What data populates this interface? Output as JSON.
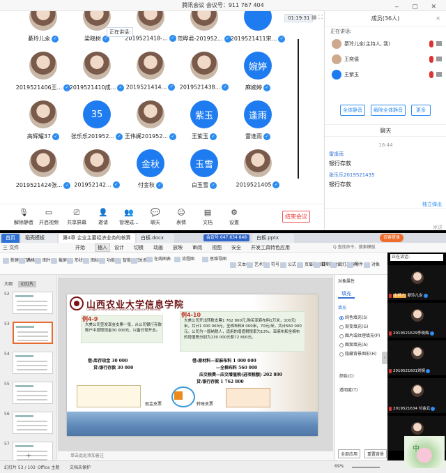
{
  "meeting": {
    "window_title": "腾讯会议 会议号：911 767 404",
    "timer": "01:19:31",
    "speaking_tip": "正在讲话:",
    "participants": [
      {
        "name": "綦玲儿氽",
        "kind": "photo",
        "label": ""
      },
      {
        "name": "梁晓树",
        "kind": "photo",
        "label": ""
      },
      {
        "name": "2019521418-...",
        "kind": "photo",
        "label": ""
      },
      {
        "name": "范晔君-201952...",
        "kind": "photo",
        "label": ""
      },
      {
        "name": "2019521411宋...",
        "kind": "blue",
        "label": ""
      },
      {
        "name": "2019521406王...",
        "kind": "photo",
        "label": ""
      },
      {
        "name": "2019521410成...",
        "kind": "photo",
        "label": ""
      },
      {
        "name": "2019521414...",
        "kind": "photo",
        "label": ""
      },
      {
        "name": "2019521438...",
        "kind": "photo",
        "label": ""
      },
      {
        "name": "麻婉婷",
        "kind": "blue",
        "label": "婉婷"
      },
      {
        "name": "高辉耀37",
        "kind": "photo",
        "label": ""
      },
      {
        "name": "张乐乐201952...",
        "kind": "blue",
        "label": "35"
      },
      {
        "name": "王伟娓201952...",
        "kind": "photo",
        "label": ""
      },
      {
        "name": "王紫玉",
        "kind": "blue",
        "label": "紫玉"
      },
      {
        "name": "雷逢雨",
        "kind": "blue",
        "label": "逢雨"
      },
      {
        "name": "2019521424张...",
        "kind": "photo",
        "label": ""
      },
      {
        "name": "201952142...",
        "kind": "photo",
        "label": ""
      },
      {
        "name": "付金秋",
        "kind": "blue",
        "label": "金秋"
      },
      {
        "name": "白玉雪",
        "kind": "blue",
        "label": "玉雪"
      },
      {
        "name": "2019521405",
        "kind": "photo",
        "label": ""
      }
    ],
    "toolbar": [
      {
        "icon": "mic-icon",
        "label": "解除静音"
      },
      {
        "icon": "camera-icon",
        "label": "开启视频"
      },
      {
        "icon": "screen-share-icon",
        "label": "共享屏幕"
      },
      {
        "icon": "invite-icon",
        "label": "邀请"
      },
      {
        "icon": "members-icon",
        "label": "管理成..."
      },
      {
        "icon": "chat-icon",
        "label": "聊天"
      },
      {
        "icon": "emoji-icon",
        "label": "表情"
      },
      {
        "icon": "document-icon",
        "label": "文档"
      },
      {
        "icon": "settings-icon",
        "label": "设置"
      }
    ],
    "end_button": "结束会议",
    "members_title": "成员(36人)",
    "members_speaking": "正在讲话:",
    "members": [
      {
        "name": "綦玲儿氽(主持人, 我)",
        "kind": "photo"
      },
      {
        "name": "王奕僖",
        "kind": "photo"
      },
      {
        "name": "王紫玉",
        "kind": "blue"
      }
    ],
    "mute_all": "全体静音",
    "unmute_all": "解除全体静音",
    "more": "更多",
    "chat_title": "聊天",
    "chat_time": "16:44",
    "chat_messages": [
      {
        "name": "雷逢雨",
        "text": "银行存款"
      },
      {
        "name": "张乐乐2019521435",
        "text": "银行存款"
      }
    ],
    "popout": "独立弹出",
    "send": "发送"
  },
  "wps": {
    "tabs": [
      "首页",
      "稻壳模板",
      "第4章 企业主要经济业务的核算",
      "白板.docx",
      "会议号 647 834 848",
      "白板.pptx"
    ],
    "login": "访客登录",
    "menus": [
      "三 文件",
      "开始",
      "插入",
      "设计",
      "切换",
      "动画",
      "放映",
      "审阅",
      "视图",
      "安全",
      "开发工具",
      "特色应用"
    ],
    "active_menu": "插入",
    "search": "Q 查找命令、搜索模板",
    "ribbon": [
      "新建幻灯片",
      "表格",
      "图片",
      "截屏",
      "形状",
      "图标",
      "功能图",
      "智能图形",
      "关系图",
      "在线图表",
      "流程图",
      "思维导图",
      "文本框",
      "艺术字",
      "符号",
      "公式",
      "页眉和页脚",
      "日期和时间",
      "幻灯片编号",
      "附件",
      "对象"
    ],
    "outline_tab": "大纲",
    "slides_tab": "幻灯片",
    "thumb_numbers": [
      "52",
      "53",
      "54",
      "55",
      "56",
      "57"
    ],
    "slide": {
      "uni_name": "山西农业大学信息学院",
      "uni_en": "College of Information, Shanxi Agricultural University",
      "ex1_title": "例4-9",
      "ex1_text": "大美公司签发现金支票一张，从公司银行存款账户中提取现金30 000元，以备日常开支。",
      "ex1_entry": [
        "借:库存现金        30 000",
        "贷:银行存款        30 000"
      ],
      "ex2_title": "例4-10",
      "ex2_text": "大美公司开出转账支票1 762 800元,购买亚麻布料1万米，100元/米，共计1 000 000元，全棉布料8 000米，70元/米，共计560 000元。公司为一般纳税人，适用的增值税税率为13%。亚麻布和全棉布的增值税分别为130 000元和72 800元。",
      "ex2_entry": [
        "借:原材料—亚麻布料              1 000 000",
        "—全棉布料                560 000",
        "应交税费—应交增值税(进项税额)   202 800",
        "贷:银行存款                    1 762 800"
      ],
      "cheque_label1": "现金支票",
      "cheque_label2": "转账支票",
      "cheque_center": "银行"
    },
    "notes_placeholder": "单击此处添加备注",
    "status": [
      "幻灯片 53 / 103",
      "Office 主题",
      "文档未保护"
    ],
    "zoom": "69%",
    "props": {
      "title": "对象属性",
      "fill_tab": "填充",
      "fill_label": "填充",
      "options": [
        "纯色填充(S)",
        "渐变填充(G)",
        "图片或纹理填充(P)",
        "图案填充(A)",
        "隐藏背景图形(H)"
      ],
      "color": "颜色(C)",
      "transparency": "透明度(T)",
      "apply_all": "全部应用",
      "reset": "重置背景"
    },
    "video": {
      "speaking": "正在讲话:",
      "tiles": [
        {
          "label": "綦玲儿氽",
          "host": "主持人"
        },
        {
          "label": "2019521629李晓梅",
          "host": ""
        },
        {
          "label": "2019521601刘婉",
          "host": ""
        },
        {
          "label": "2019521634 付金云",
          "host": ""
        },
        {
          "label": "",
          "host": ""
        }
      ]
    }
  }
}
